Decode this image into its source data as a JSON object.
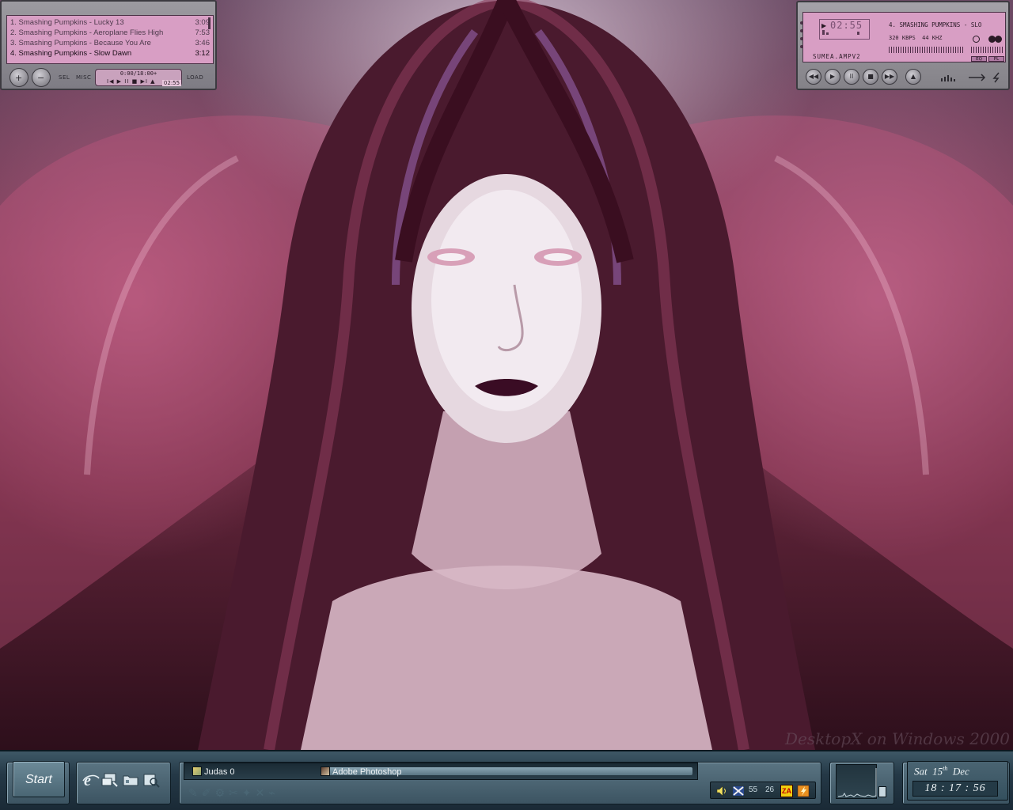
{
  "desktop": {
    "watermark": "DesktopX on Windows 2000"
  },
  "playlist": {
    "items": [
      {
        "title": "1. Smashing Pumpkins - Lucky 13",
        "duration": "3:09"
      },
      {
        "title": "2. Smashing Pumpkins - Aeroplane Flies High",
        "duration": "7:53"
      },
      {
        "title": "3. Smashing Pumpkins - Because You Are",
        "duration": "3:46"
      },
      {
        "title": "4. Smashing Pumpkins - Slow Dawn",
        "duration": "3:12"
      }
    ],
    "active_index": 3,
    "sel_label": "SEL",
    "misc_label": "MISC",
    "load_label": "LOAD",
    "total_time": "0:00/18:00+",
    "transport_glyphs": "I◀ ▶ II ■ ▶I ▲",
    "elapsed": "02:55"
  },
  "player": {
    "time_display": "02:55",
    "ticker": "4. SMASHING PUMPKINS - SLO",
    "kbps": "320 KBPS",
    "khz": "44 KHZ",
    "skin_name": "SUMEA.AMPV2",
    "eq_label": "EQ",
    "pl_label": "PL",
    "buttons": [
      "◀◀",
      "▶",
      "II",
      "■",
      "▶▶",
      "▲"
    ],
    "accent": "#d89ec4"
  },
  "taskbar": {
    "start_label": "Start",
    "quicklaunch": [
      "ie-icon",
      "desktop-icon",
      "folder-icon",
      "search-icon"
    ],
    "tasks": [
      {
        "label": "Judas 0",
        "icon": "folder-icon"
      },
      {
        "label": "Adobe Photoshop",
        "icon": "photoshop-icon"
      }
    ],
    "tray": {
      "num1": "55",
      "num2": "26",
      "za_label": "ZA"
    },
    "clock": {
      "day": "Sat",
      "date_num": "15",
      "date_suffix": "th",
      "month": "Dec",
      "time": "18 : 17 : 56"
    }
  }
}
